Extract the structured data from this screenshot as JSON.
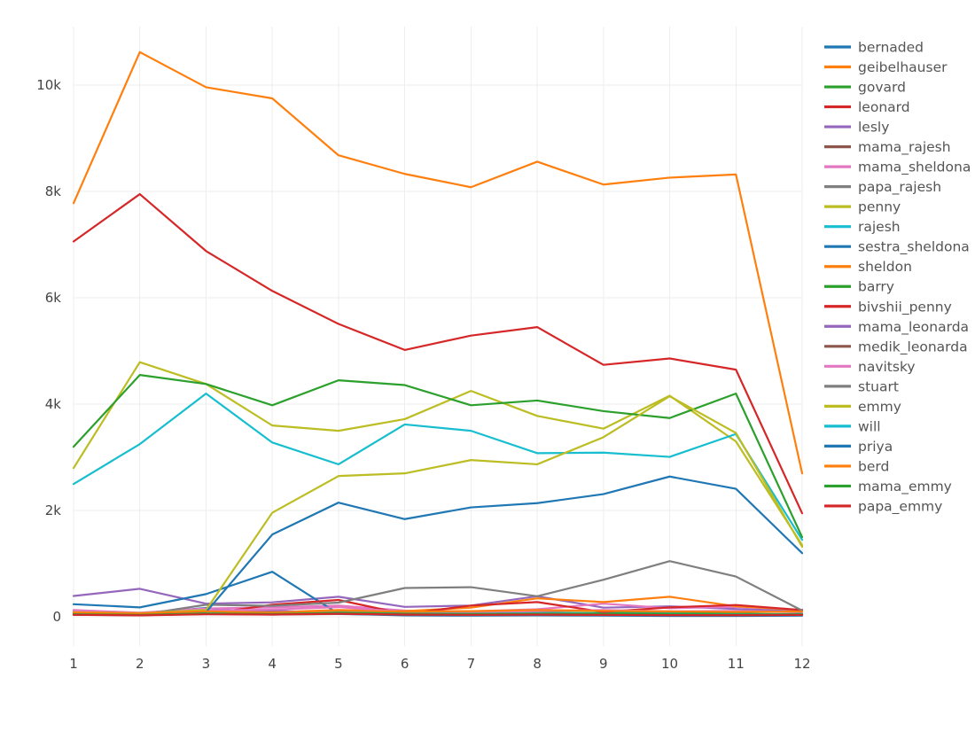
{
  "chart_data": {
    "type": "line",
    "title": "",
    "subtitle": "",
    "xlabel": "",
    "ylabel": "",
    "x": [
      1,
      2,
      3,
      4,
      5,
      6,
      7,
      8,
      9,
      10,
      11,
      12
    ],
    "categories": [
      "1",
      "2",
      "3",
      "4",
      "5",
      "6",
      "7",
      "8",
      "9",
      "10",
      "11",
      "12"
    ],
    "xtick_labels": [
      "1",
      "2",
      "3",
      "4",
      "5",
      "6",
      "7",
      "8",
      "9",
      "10",
      "11",
      "12"
    ],
    "ytick_labels": [
      "0",
      "2k",
      "4k",
      "6k",
      "8k",
      "10k"
    ],
    "ytick_values": [
      0,
      2000,
      4000,
      6000,
      8000,
      10000
    ],
    "xlim": [
      1,
      12
    ],
    "ylim": [
      -180,
      11100
    ],
    "grid": true,
    "grid_color": "#eeeeee",
    "legend_position": "right",
    "background": "#ffffff",
    "series": [
      {
        "name": "bernaded",
        "color": "#1f77b4",
        "values": [
          120,
          60,
          170,
          60,
          55,
          50,
          50,
          45,
          40,
          45,
          40,
          55
        ]
      },
      {
        "name": "geibelhauser",
        "color": "#ff7f0e",
        "values": [
          7780,
          10620,
          9960,
          9750,
          8680,
          8330,
          8080,
          8560,
          8130,
          8260,
          8320,
          2700
        ]
      },
      {
        "name": "govard",
        "color": "#2ca02c",
        "values": [
          80,
          60,
          90,
          75,
          110,
          95,
          85,
          80,
          75,
          90,
          85,
          105
        ]
      },
      {
        "name": "leonard",
        "color": "#d62728",
        "values": [
          7060,
          7950,
          6880,
          6130,
          5510,
          5020,
          5290,
          5450,
          4740,
          4860,
          4650,
          1950
        ]
      },
      {
        "name": "lesly",
        "color": "#9467bd",
        "values": [
          395,
          530,
          250,
          275,
          380,
          190,
          215,
          390,
          175,
          200,
          150,
          110
        ]
      },
      {
        "name": "mama_rajesh",
        "color": "#8c564b",
        "values": [
          55,
          45,
          80,
          60,
          70,
          50,
          45,
          55,
          50,
          45,
          40,
          45
        ]
      },
      {
        "name": "mama_sheldona",
        "color": "#e377c2",
        "values": [
          130,
          80,
          160,
          180,
          215,
          120,
          105,
          145,
          250,
          165,
          190,
          135
        ]
      },
      {
        "name": "papa_rajesh",
        "color": "#7f7f7f",
        "values": [
          40,
          35,
          60,
          45,
          55,
          40,
          35,
          45,
          40,
          35,
          30,
          35
        ]
      },
      {
        "name": "penny",
        "color": "#bcbd22",
        "values": [
          2800,
          4790,
          4380,
          3600,
          3500,
          3720,
          4250,
          3780,
          3540,
          4160,
          3300,
          1350
        ]
      },
      {
        "name": "rajesh",
        "color": "#17becf",
        "values": [
          2500,
          3250,
          4200,
          3280,
          2870,
          3620,
          3500,
          3080,
          3090,
          3010,
          3440,
          1450
        ]
      },
      {
        "name": "sestra_sheldona",
        "color": "#1f77b4",
        "values": [
          240,
          180,
          430,
          850,
          60,
          30,
          25,
          30,
          25,
          20,
          20,
          25
        ]
      },
      {
        "name": "sheldon",
        "color": "#ff7f0e",
        "values": [
          80,
          60,
          110,
          90,
          130,
          110,
          175,
          350,
          280,
          380,
          200,
          130
        ]
      },
      {
        "name": "barry",
        "color": "#2ca02c",
        "values": [
          3200,
          4550,
          4380,
          3980,
          4450,
          4360,
          3980,
          4070,
          3870,
          3740,
          4200,
          1500
        ]
      },
      {
        "name": "bivshii_penny",
        "color": "#d62728",
        "values": [
          60,
          35,
          55,
          230,
          320,
          55,
          215,
          280,
          95,
          180,
          225,
          130
        ]
      },
      {
        "name": "mama_leonarda",
        "color": "#9467bd",
        "values": [
          70,
          55,
          85,
          120,
          70,
          65,
          60,
          70,
          60,
          55,
          50,
          55
        ]
      },
      {
        "name": "medik_leonarda",
        "color": "#8c564b",
        "values": [
          45,
          40,
          60,
          90,
          65,
          45,
          40,
          45,
          40,
          40,
          35,
          40
        ]
      },
      {
        "name": "navitsky",
        "color": "#e377c2",
        "values": [
          95,
          60,
          120,
          140,
          185,
          95,
          90,
          110,
          130,
          105,
          115,
          90
        ]
      },
      {
        "name": "stuart",
        "color": "#7f7f7f",
        "values": [
          60,
          40,
          230,
          210,
          270,
          545,
          560,
          390,
          700,
          1050,
          760,
          120
        ]
      },
      {
        "name": "emmy",
        "color": "#bcbd22",
        "values": [
          90,
          70,
          130,
          1960,
          2650,
          2700,
          2950,
          2870,
          3380,
          4150,
          3460,
          1320
        ]
      },
      {
        "name": "will",
        "color": "#17becf",
        "values": [
          50,
          40,
          70,
          60,
          80,
          65,
          60,
          70,
          60,
          55,
          50,
          55
        ]
      },
      {
        "name": "priya",
        "color": "#1f77b4",
        "values": [
          70,
          50,
          90,
          1550,
          2150,
          1840,
          2060,
          2140,
          2310,
          2640,
          2410,
          1200
        ]
      },
      {
        "name": "berd",
        "color": "#ff7f0e",
        "values": [
          85,
          70,
          105,
          85,
          120,
          100,
          110,
          130,
          115,
          105,
          95,
          100
        ]
      },
      {
        "name": "mama_emmy",
        "color": "#2ca02c",
        "values": [
          50,
          40,
          65,
          55,
          75,
          60,
          55,
          60,
          55,
          50,
          45,
          50
        ]
      },
      {
        "name": "papa_emmy",
        "color": "#d62728",
        "values": [
          40,
          30,
          50,
          45,
          60,
          45,
          40,
          45,
          40,
          35,
          35,
          40
        ]
      }
    ]
  },
  "legend": {
    "entries": [
      {
        "label": "bernaded"
      },
      {
        "label": "geibelhauser"
      },
      {
        "label": "govard"
      },
      {
        "label": "leonard"
      },
      {
        "label": "lesly"
      },
      {
        "label": "mama_rajesh"
      },
      {
        "label": "mama_sheldona"
      },
      {
        "label": "papa_rajesh"
      },
      {
        "label": "penny"
      },
      {
        "label": "rajesh"
      },
      {
        "label": "sestra_sheldona"
      },
      {
        "label": "sheldon"
      },
      {
        "label": "barry"
      },
      {
        "label": "bivshii_penny"
      },
      {
        "label": "mama_leonarda"
      },
      {
        "label": "medik_leonarda"
      },
      {
        "label": "navitsky"
      },
      {
        "label": "stuart"
      },
      {
        "label": "emmy"
      },
      {
        "label": "will"
      },
      {
        "label": "priya"
      },
      {
        "label": "berd"
      },
      {
        "label": "mama_emmy"
      },
      {
        "label": "papa_emmy"
      }
    ]
  }
}
